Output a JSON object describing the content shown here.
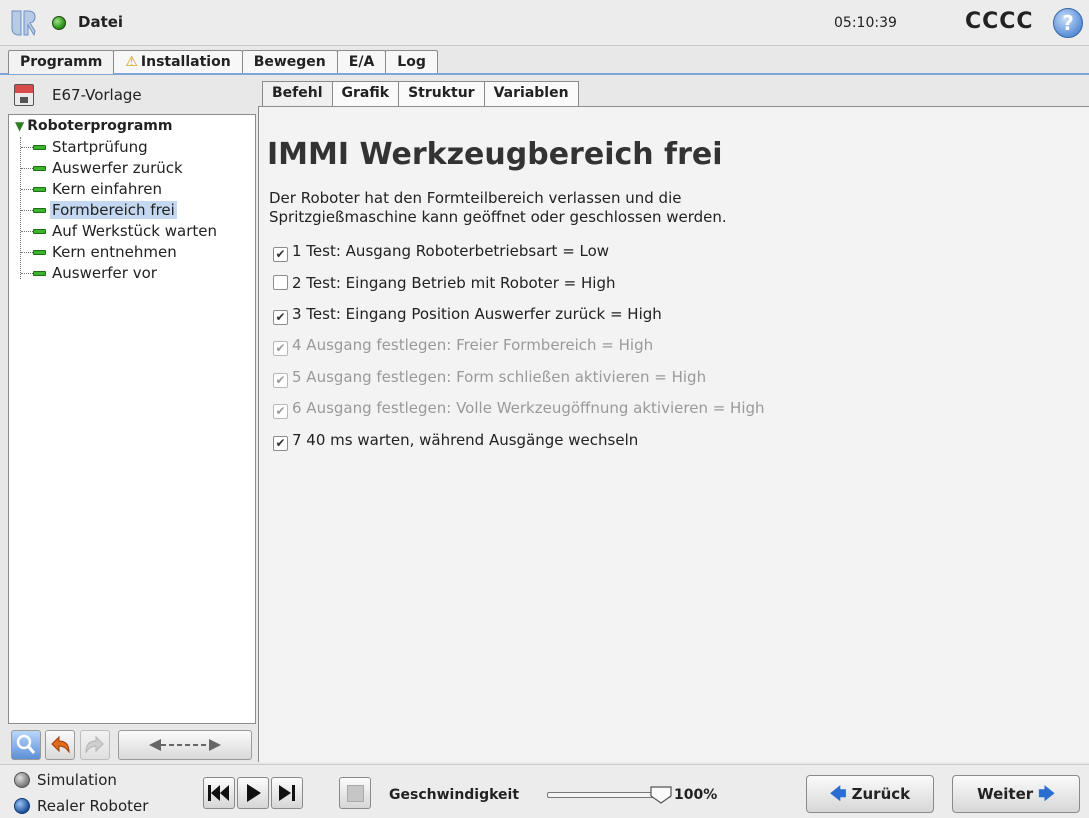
{
  "header": {
    "file_menu": "Datei",
    "clock": "05:10:39",
    "robot_name": "CCCC",
    "help_symbol": "?"
  },
  "main_tabs": [
    {
      "label": "Programm",
      "active": true
    },
    {
      "label": "Installation",
      "warning": true
    },
    {
      "label": "Bewegen"
    },
    {
      "label": "E/A"
    },
    {
      "label": "Log"
    }
  ],
  "program": {
    "name": "E67-Vorlage",
    "root": "Roboterprogramm",
    "nodes": [
      "Startprüfung",
      "Auswerfer zurück",
      "Kern einfahren",
      "Formbereich frei",
      "Auf Werkstück warten",
      "Kern entnehmen",
      "Auswerfer vor"
    ],
    "selected_index": 3
  },
  "sub_tabs": [
    "Befehl",
    "Grafik",
    "Struktur",
    "Variablen"
  ],
  "node": {
    "title": "IMMI Werkzeugbereich frei",
    "description_line1": "Der Roboter hat den Formteilbereich verlassen und die",
    "description_line2": "Spritzgießmaschine kann geöffnet oder geschlossen werden.",
    "checks": [
      {
        "label": "1 Test: Ausgang Roboterbetriebsart = Low",
        "checked": true,
        "enabled": true
      },
      {
        "label": "2 Test: Eingang Betrieb mit Roboter = High",
        "checked": false,
        "enabled": true
      },
      {
        "label": "3 Test: Eingang Position Auswerfer zurück = High",
        "checked": true,
        "enabled": true
      },
      {
        "label": "4 Ausgang festlegen: Freier Formbereich = High",
        "checked": true,
        "enabled": false
      },
      {
        "label": "5 Ausgang festlegen: Form schließen aktivieren = High",
        "checked": true,
        "enabled": false
      },
      {
        "label": "6 Ausgang festlegen: Volle Werkzeugöffnung aktivieren = High",
        "checked": true,
        "enabled": false
      },
      {
        "label": "7 40 ms warten, während Ausgänge wechseln",
        "checked": true,
        "enabled": true
      }
    ]
  },
  "footer": {
    "mode_simulation": "Simulation",
    "mode_real": "Realer Roboter",
    "speed_label": "Geschwindigkeit",
    "speed_value": "100%",
    "speed_fraction": 1.0,
    "back_label": "Zurück",
    "next_label": "Weiter"
  },
  "colors": {
    "accent": "#2a6fcf",
    "status_ok": "#2e9a1a",
    "selection": "#c4d8f2"
  }
}
